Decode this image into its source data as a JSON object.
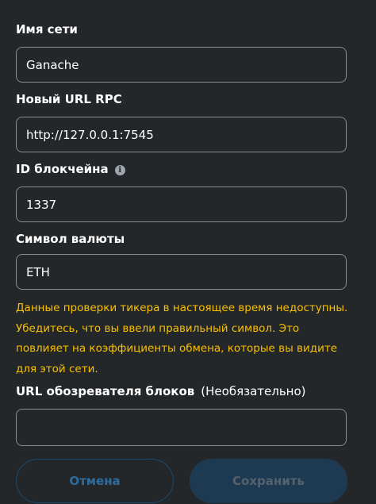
{
  "fields": {
    "network_name": {
      "label": "Имя сети",
      "value": "Ganache"
    },
    "rpc_url": {
      "label": "Новый URL RPC",
      "value": "http://127.0.0.1:7545"
    },
    "chain_id": {
      "label": "ID блокчейна",
      "value": "1337",
      "info_icon": "info-icon"
    },
    "currency_symbol": {
      "label": "Символ валюты",
      "value": "ETH"
    },
    "block_explorer": {
      "label": "URL обозревателя блоков",
      "optional": "(Необязательно)",
      "value": ""
    }
  },
  "warning": {
    "text": "Данные проверки тикера в настоящее время недоступны. Убедитесь, что вы ввели правильный символ. Это повлияет на коэффициенты обмена, которые вы видите для этой сети.",
    "color": "#f8c000"
  },
  "buttons": {
    "cancel": "Отмена",
    "save": "Сохранить"
  },
  "colors": {
    "background": "#24272a",
    "border": "#848c96",
    "accent": "#2e6c9e"
  }
}
